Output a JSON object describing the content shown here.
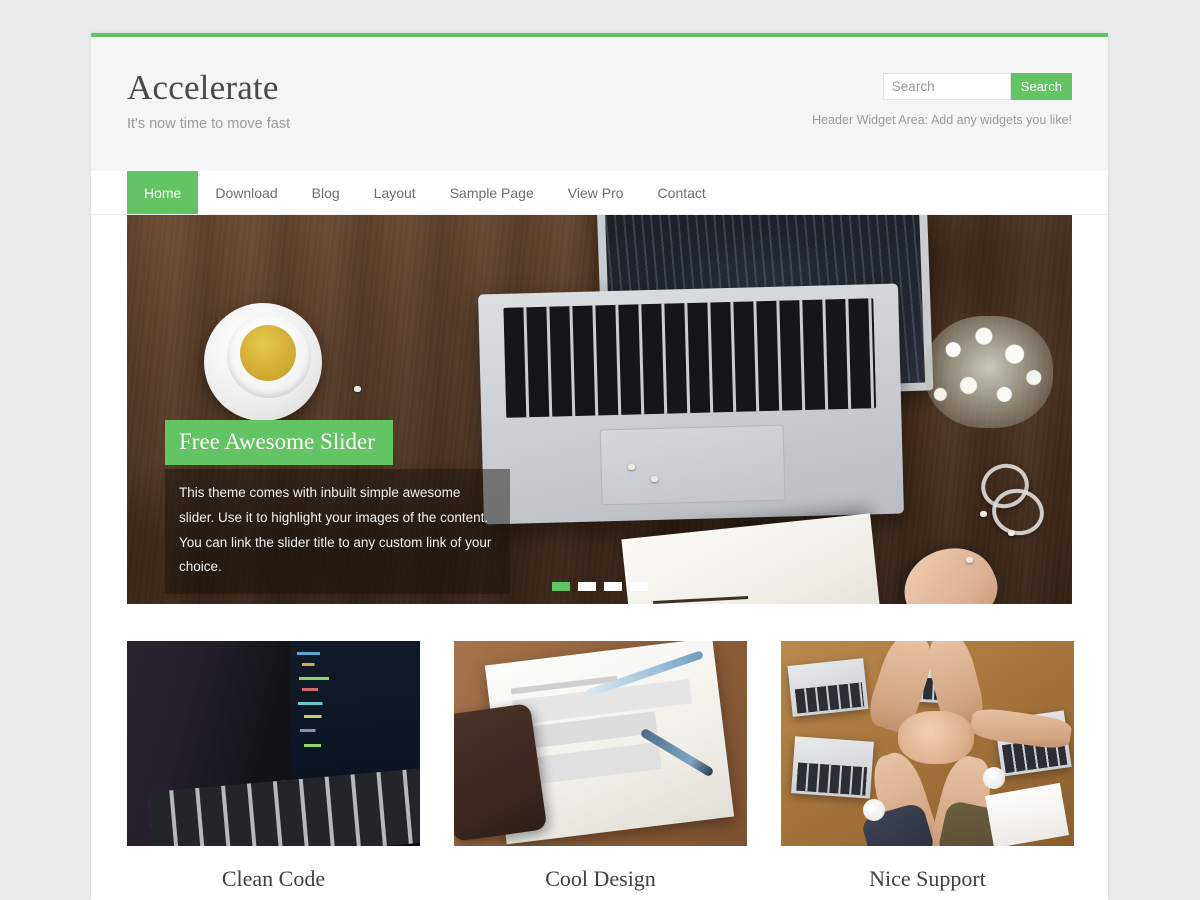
{
  "theme": {
    "accent_color": "#62c462",
    "page_background": "#ebebeb",
    "header_background": "#f5f5f5"
  },
  "header": {
    "site_title": "Accelerate",
    "tagline": "It's now time to move fast",
    "widget_note": "Header Widget Area: Add any widgets you like!",
    "search": {
      "placeholder": "Search",
      "value": "",
      "button_label": "Search"
    }
  },
  "nav": {
    "items": [
      {
        "label": "Home",
        "active": true
      },
      {
        "label": "Download",
        "active": false
      },
      {
        "label": "Blog",
        "active": false
      },
      {
        "label": "Layout",
        "active": false
      },
      {
        "label": "Sample Page",
        "active": false
      },
      {
        "label": "View Pro",
        "active": false
      },
      {
        "label": "Contact",
        "active": false
      }
    ]
  },
  "slider": {
    "title": "Free Awesome Slider",
    "description": "This theme comes with inbuilt simple awesome slider. Use it to highlight your images of the content. You can link the slider title to any custom link of your choice.",
    "slide_count": 4,
    "active_slide": 1,
    "image_alt": "Wooden desk flat lay with a cup of tea, open laptop, white flowers, bangles and an open notebook"
  },
  "features": [
    {
      "title": "Clean Code",
      "text": "",
      "image_alt": "Laptop screen showing colorful source code in a dark editor"
    },
    {
      "title": "Cool Design",
      "text": "",
      "image_alt": "Spiral notebook with hand drawn website wireframes, two pens and a phone on a wooden table"
    },
    {
      "title": "Nice Support",
      "text": "",
      "image_alt": "Overhead view of four people stacking hands over a wooden desk with laptops"
    }
  ]
}
